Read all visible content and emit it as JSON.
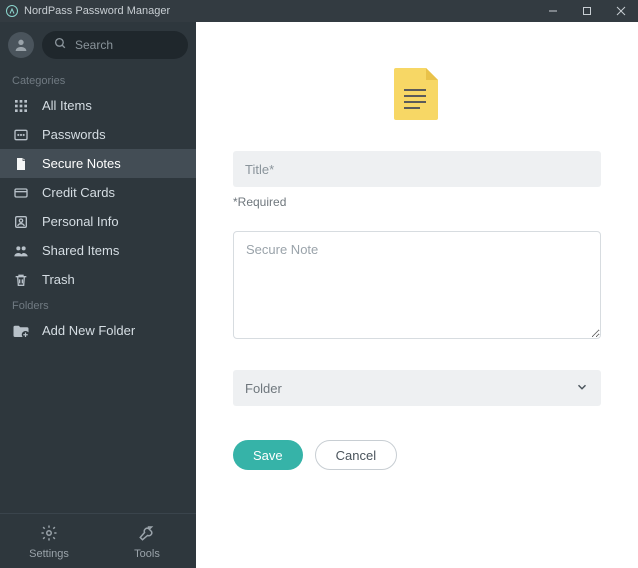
{
  "window": {
    "title": "NordPass Password Manager"
  },
  "sidebar": {
    "search_placeholder": "Search",
    "categories_label": "Categories",
    "folders_label": "Folders",
    "items": [
      {
        "icon": "grid-icon",
        "label": "All Items"
      },
      {
        "icon": "key-icon",
        "label": "Passwords"
      },
      {
        "icon": "note-icon",
        "label": "Secure Notes",
        "active": true
      },
      {
        "icon": "card-icon",
        "label": "Credit Cards"
      },
      {
        "icon": "person-icon",
        "label": "Personal Info"
      },
      {
        "icon": "shared-icon",
        "label": "Shared Items"
      },
      {
        "icon": "trash-icon",
        "label": "Trash"
      }
    ],
    "folder_items": [
      {
        "icon": "add-folder-icon",
        "label": "Add New Folder"
      }
    ],
    "bottom": {
      "settings_label": "Settings",
      "tools_label": "Tools"
    }
  },
  "form": {
    "title_placeholder": "Title*",
    "required_text": "*Required",
    "note_placeholder": "Secure Note",
    "folder_label": "Folder",
    "save_label": "Save",
    "cancel_label": "Cancel"
  },
  "colors": {
    "accent": "#36b3a8",
    "sidebar_bg": "#2e373d",
    "titlebar_bg": "#333b41"
  }
}
